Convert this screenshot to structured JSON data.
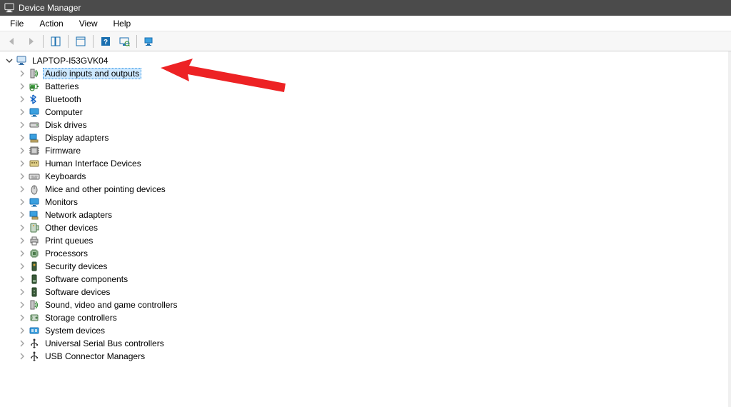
{
  "title": "Device Manager",
  "menu": {
    "file": "File",
    "action": "Action",
    "view": "View",
    "help": "Help"
  },
  "root": "LAPTOP-I53GVK04",
  "categories": [
    {
      "label": "Audio inputs and outputs",
      "icon": "speaker",
      "selected": true
    },
    {
      "label": "Batteries",
      "icon": "battery"
    },
    {
      "label": "Bluetooth",
      "icon": "bluetooth"
    },
    {
      "label": "Computer",
      "icon": "monitor-blue"
    },
    {
      "label": "Disk drives",
      "icon": "disk"
    },
    {
      "label": "Display adapters",
      "icon": "display-adapter"
    },
    {
      "label": "Firmware",
      "icon": "firmware"
    },
    {
      "label": "Human Interface Devices",
      "icon": "hid"
    },
    {
      "label": "Keyboards",
      "icon": "keyboard"
    },
    {
      "label": "Mice and other pointing devices",
      "icon": "mouse"
    },
    {
      "label": "Monitors",
      "icon": "monitor-blue"
    },
    {
      "label": "Network adapters",
      "icon": "network"
    },
    {
      "label": "Other devices",
      "icon": "other"
    },
    {
      "label": "Print queues",
      "icon": "printer"
    },
    {
      "label": "Processors",
      "icon": "processor"
    },
    {
      "label": "Security devices",
      "icon": "security"
    },
    {
      "label": "Software components",
      "icon": "software-comp"
    },
    {
      "label": "Software devices",
      "icon": "software-dev"
    },
    {
      "label": "Sound, video and game controllers",
      "icon": "speaker"
    },
    {
      "label": "Storage controllers",
      "icon": "storage"
    },
    {
      "label": "System devices",
      "icon": "system"
    },
    {
      "label": "Universal Serial Bus controllers",
      "icon": "usb"
    },
    {
      "label": "USB Connector Managers",
      "icon": "usb"
    }
  ]
}
